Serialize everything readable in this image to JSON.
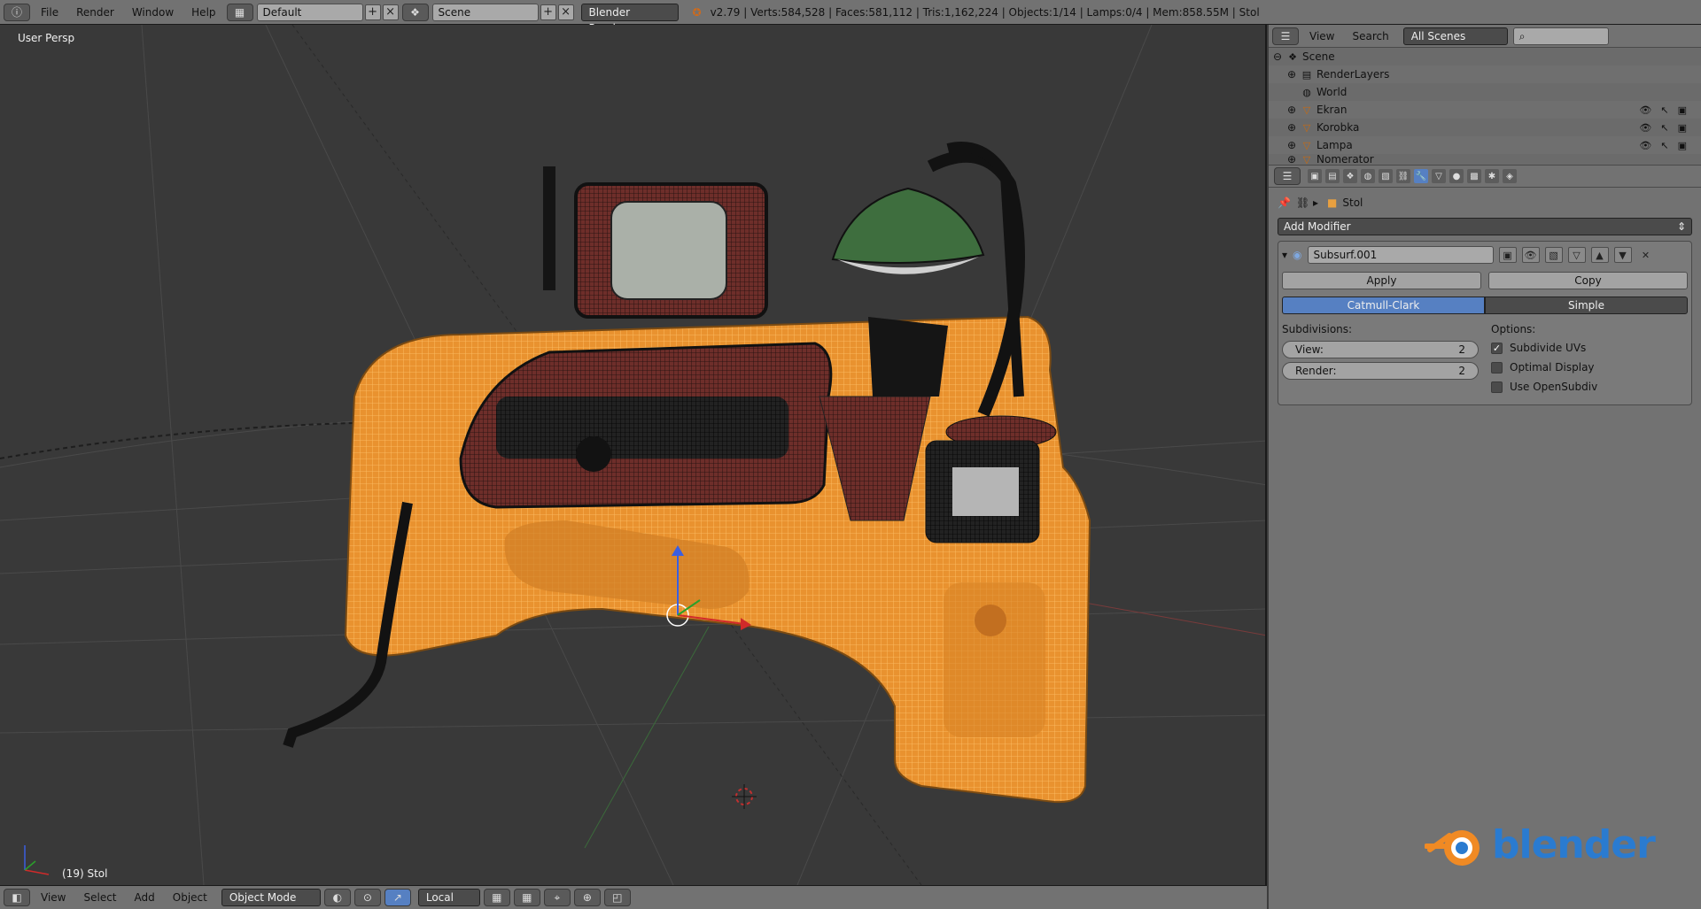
{
  "topbar": {
    "menu": [
      "File",
      "Render",
      "Window",
      "Help"
    ],
    "layout": "Default",
    "scene": "Scene",
    "engine": "Blender Render",
    "status": "v2.79 | Verts:584,528 | Faces:581,112 | Tris:1,162,224 | Objects:1/14 | Lamps:0/4 | Mem:858.55M | Stol"
  },
  "viewport": {
    "label": "User Persp",
    "object_label": "(19) Stol",
    "header": {
      "menu": [
        "View",
        "Select",
        "Add",
        "Object"
      ],
      "mode": "Object Mode",
      "orientation": "Local"
    }
  },
  "outliner": {
    "menu": [
      "View",
      "Search"
    ],
    "display": "All Scenes",
    "rows": [
      {
        "name": "Scene",
        "icon": "scene-icon"
      },
      {
        "name": "RenderLayers",
        "icon": "renderlayers-icon"
      },
      {
        "name": "World",
        "icon": "world-icon"
      },
      {
        "name": "Ekran",
        "icon": "mesh-icon"
      },
      {
        "name": "Korobka",
        "icon": "mesh-icon"
      },
      {
        "name": "Lampa",
        "icon": "mesh-icon"
      },
      {
        "name": "Nomerator",
        "icon": "mesh-icon"
      }
    ]
  },
  "properties": {
    "object": "Stol",
    "add_modifier": "Add Modifier",
    "modifier": {
      "name": "Subsurf.001",
      "apply": "Apply",
      "copy": "Copy",
      "types": [
        "Catmull-Clark",
        "Simple"
      ],
      "subdivisions_label": "Subdivisions:",
      "view_label": "View:",
      "view_value": "2",
      "render_label": "Render:",
      "render_value": "2",
      "options_label": "Options:",
      "options": [
        {
          "label": "Subdivide UVs",
          "checked": true
        },
        {
          "label": "Optimal Display",
          "checked": false
        },
        {
          "label": "Use OpenSubdiv",
          "checked": false
        }
      ]
    }
  },
  "branding": {
    "text": "blender",
    "color": "#2a7bd0",
    "accent": "#f08a24"
  },
  "colors": {
    "selected_wire": "#f5a83c",
    "desk_fill": "#e08a2a",
    "machine": "#8a3a35"
  }
}
